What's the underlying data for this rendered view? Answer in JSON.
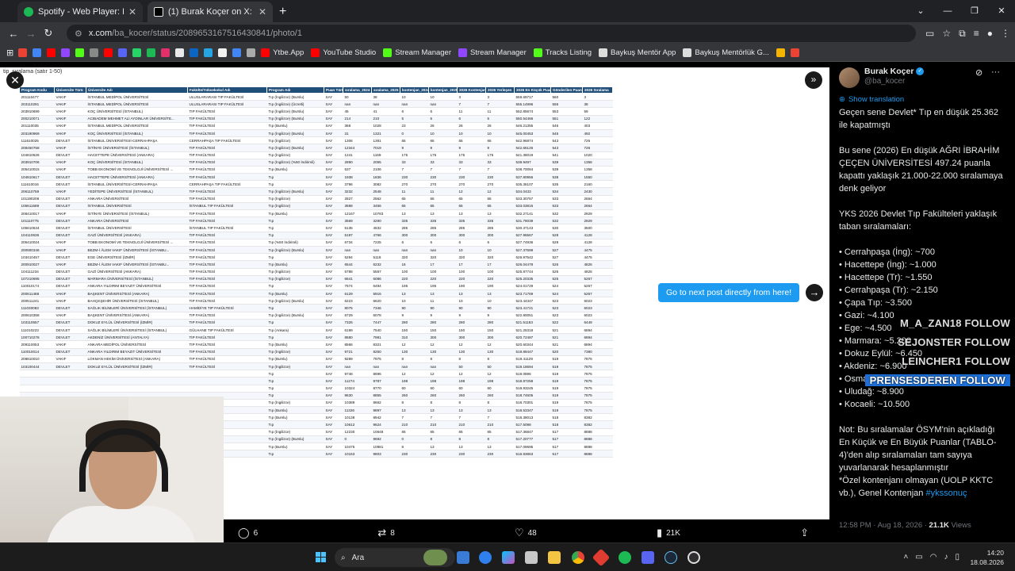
{
  "browser": {
    "tabs": [
      {
        "title": "Spotify - Web Player: Herkes için",
        "color": "#1db954",
        "active": false
      },
      {
        "title": "(1) Burak Koçer on X: \"Geçen se",
        "color": "#e7e9ea",
        "active": true
      }
    ],
    "new_tab": "+",
    "url_site": "x.com",
    "url_path": "/ba_kocer/status/2089653167516430841/photo/1",
    "bookmarks": [
      {
        "label": "",
        "color": "#ea4335"
      },
      {
        "label": "",
        "color": "#4285f4"
      },
      {
        "label": "",
        "color": "#ff0000"
      },
      {
        "label": "",
        "color": "#9147ff"
      },
      {
        "label": "",
        "color": "#53fc18"
      },
      {
        "label": "",
        "color": "#888888"
      },
      {
        "label": "",
        "color": "#ff0000"
      },
      {
        "label": "",
        "color": "#5865f2"
      },
      {
        "label": "",
        "color": "#25d366"
      },
      {
        "label": "",
        "color": "#1db954"
      },
      {
        "label": "",
        "color": "#e1306c"
      },
      {
        "label": "",
        "color": "#e7e9ea"
      },
      {
        "label": "",
        "color": "#0a66c2"
      },
      {
        "label": "",
        "color": "#26a5e4"
      },
      {
        "label": "",
        "color": "#f2f2f2"
      },
      {
        "label": "",
        "color": "#4285f4"
      },
      {
        "label": "",
        "color": "#aaaaaa"
      },
      {
        "label": "Ytbe.App",
        "color": "#ff0000"
      },
      {
        "label": "YouTube Studio",
        "color": "#ff0000"
      },
      {
        "label": "Stream Manager",
        "color": "#53fc18"
      },
      {
        "label": "Stream Manager",
        "color": "#9147ff"
      },
      {
        "label": "Tracks Listing",
        "color": "#53fc18"
      },
      {
        "label": "Baykuş Mentör App",
        "color": "#dddddd"
      },
      {
        "label": "Baykuş Mentörlük G...",
        "color": "#dddddd"
      },
      {
        "label": "",
        "color": "#f4b400"
      },
      {
        "label": "",
        "color": "#ea4335"
      }
    ]
  },
  "image": {
    "sheet_title": "tip_sıralama  (satır 1-50)",
    "columns": [
      "Program Kodu",
      "Üniversite Türü",
      "Üniversite Adı",
      "Fakülte/Yüksekokul Adı",
      "Program Adı",
      "Puan Türü",
      "sıralama_2024",
      "sıralama_2025",
      "kontenjan_2024",
      "kontenjan_2025",
      "2026 Kontenjan",
      "2026 Yerleşen",
      "2026 En Küçük Puan",
      "Gönderilen Puan",
      "2026 Sıralama"
    ],
    "rows": [
      [
        "201110477",
        "VAKIF",
        "İSTANBUL MEDİPOL ÜNİVERSİTESİ",
        "ULUSLARARASI TIP FAKÜLTESİ",
        "Tıp (İngilizce) (Burslu)",
        "SAY",
        "50",
        "38",
        "10",
        "10",
        "3",
        "3",
        "559.69717",
        "560",
        "3"
      ],
      [
        "203110291",
        "VAKIF",
        "İSTANBUL MEDİPOL ÜNİVERSİTESİ",
        "ULUSLARARASI TIP FAKÜLTESİ",
        "Tıp (İngilizce) (Ücretli)",
        "SAY",
        "nan",
        "nan",
        "nan",
        "nan",
        "7",
        "7",
        "555.14996",
        "555",
        "38"
      ],
      [
        "203910699",
        "VAKIF",
        "KOÇ ÜNİVERSİTESİ (İSTANBUL)",
        "TIP FAKÜLTESİ",
        "Tıp (İngilizce) (Burslu)",
        "SAY",
        "45",
        "41",
        "6",
        "6",
        "11",
        "11",
        "552.85674",
        "553",
        "59"
      ],
      [
        "200210071",
        "VAKIF",
        "ACIBADEM MEHMET ALİ AYDINLAR ÜNİVERSİTE...",
        "TIP FAKÜLTESİ",
        "Tıp (İngilizce) (Burslu)",
        "SAY",
        "214",
        "210",
        "5",
        "6",
        "6",
        "6",
        "550.54466",
        "551",
        "122"
      ],
      [
        "201110035",
        "VAKIF",
        "İSTANBUL MEDİPOL ÜNİVERSİTESİ",
        "TIP FAKÜLTESİ",
        "Tıp (Burslu)",
        "SAY",
        "368",
        "1028",
        "23",
        "26",
        "26",
        "26",
        "546.21355",
        "546",
        "403"
      ],
      [
        "203190969",
        "VAKIF",
        "KOÇ ÜNİVERSİTESİ (İSTANBUL)",
        "TIP FAKÜLTESİ",
        "Tıp (İngilizce) (Burslu)",
        "SAY",
        "31",
        "1321",
        "0",
        "10",
        "10",
        "10",
        "545.00453",
        "545",
        "492"
      ],
      [
        "111610025",
        "DEVLET",
        "İSTANBUL ÜNİVERSİTESİ-CERRAHPAŞA",
        "CERRAHPAŞA TIP FAKÜLTESİ",
        "Tıp (İngilizce)",
        "SAY",
        "1306",
        "1391",
        "65",
        "65",
        "65",
        "65",
        "542.96874",
        "543",
        "726"
      ],
      [
        "208450758",
        "VAKIF",
        "İSTİNYE ÜNİVERSİTESİ (İSTANBUL)",
        "TIP FAKÜLTESİ",
        "Tıp (İngilizce) (Burslu)",
        "SAY",
        "12344",
        "7019",
        "9",
        "9",
        "9",
        "9",
        "542.66126",
        "543",
        "726"
      ],
      [
        "104810626",
        "DEVLET",
        "HACETTEPE ÜNİVERSİTESİ (ANKARA)",
        "TIP FAKÜLTESİ",
        "Tıp (İngilizce)",
        "SAY",
        "1241",
        "1169",
        "175",
        "175",
        "175",
        "175",
        "541.38019",
        "541",
        "1020"
      ],
      [
        "203910706",
        "VAKIF",
        "KOÇ ÜNİVERSİTESİ (İSTANBUL)",
        "TIP FAKÜLTESİ",
        "Tıp (İngilizce) (%50 İndirimli)",
        "SAY",
        "2890",
        "2055",
        "33",
        "33",
        "33",
        "33",
        "538.9497",
        "539",
        "1358"
      ],
      [
        "205410015",
        "VAKIF",
        "TOBB EKONOMİ VE TEKNOLOJİ ÜNİVERSİTESİ ...",
        "TIP FAKÜLTESİ",
        "Tıp (Burslu)",
        "SAY",
        "537",
        "2106",
        "7",
        "7",
        "7",
        "7",
        "538.70084",
        "539",
        "1358"
      ],
      [
        "104810617",
        "DEVLET",
        "HACETTEPE ÜNİVERSİTESİ (ANKARA)",
        "TIP FAKÜLTESİ",
        "Tıp",
        "SAY",
        "1938",
        "1836",
        "230",
        "230",
        "230",
        "230",
        "537.80956",
        "538",
        "1550"
      ],
      [
        "111610016",
        "DEVLET",
        "İSTANBUL ÜNİVERSİTESİ-CERRAHPAŞA",
        "CERRAHPAŞA TIP FAKÜLTESİ",
        "Tıp",
        "SAY",
        "3796",
        "3082",
        "270",
        "270",
        "270",
        "270",
        "535.36107",
        "535",
        "2160"
      ],
      [
        "206110759",
        "VAKIF",
        "YEDİTEPE ÜNİVERSİTESİ (İSTANBUL)",
        "TIP FAKÜLTESİ",
        "Tıp (İngilizce) (Burslu)",
        "SAY",
        "3232",
        "2548",
        "11",
        "11",
        "12",
        "12",
        "534.0433",
        "534",
        "2430"
      ],
      [
        "101190208",
        "DEVLET",
        "ANKARA ÜNİVERSİTESİ",
        "TIP FAKÜLTESİ",
        "Tıp (İngilizce)",
        "SAY",
        "2827",
        "2562",
        "65",
        "65",
        "65",
        "65",
        "533.30757",
        "533",
        "2664"
      ],
      [
        "105611589",
        "DEVLET",
        "İSTANBUL ÜNİVERSİTESİ",
        "İSTANBUL TIP FAKÜLTESİ",
        "Tıp (İngilizce)",
        "SAY",
        "3688",
        "3456",
        "65",
        "65",
        "65",
        "65",
        "533.03816",
        "533",
        "2664"
      ],
      [
        "208410017",
        "VAKIF",
        "İSTİNYE ÜNİVERSİTESİ (İSTANBUL)",
        "TIP FAKÜLTESİ",
        "Tıp (Burslu)",
        "SAY",
        "12167",
        "10783",
        "13",
        "13",
        "13",
        "13",
        "532.27141",
        "532",
        "2929"
      ],
      [
        "101110775",
        "DEVLET",
        "ANKARA ÜNİVERSİTESİ",
        "TIP FAKÜLTESİ",
        "Tıp",
        "SAY",
        "3569",
        "3290",
        "335",
        "335",
        "335",
        "335",
        "531.78039",
        "532",
        "2929"
      ],
      [
        "105610634",
        "DEVLET",
        "İSTANBUL ÜNİVERSİTESİ",
        "İSTANBUL TIP FAKÜLTESİ",
        "Tıp",
        "SAY",
        "5135",
        "4532",
        "285",
        "285",
        "285",
        "285",
        "530.37143",
        "530",
        "3500"
      ],
      [
        "104110636",
        "DEVLET",
        "GAZİ ÜNİVERSİTESİ (ANKARA)",
        "TIP FAKÜLTESİ",
        "Tıp",
        "SAY",
        "5197",
        "4766",
        "300",
        "300",
        "300",
        "300",
        "527.96567",
        "528",
        "4128"
      ],
      [
        "205410024",
        "VAKIF",
        "TOBB EKONOMİ VE TEKNOLOJİ ÜNİVERSİTESİ ...",
        "TIP FAKÜLTESİ",
        "Tıp (%50 İndirimli)",
        "SAY",
        "6734",
        "7225",
        "6",
        "6",
        "6",
        "6",
        "527.74936",
        "528",
        "4128"
      ],
      [
        "200900346",
        "VAKIF",
        "BEZM-İ ÂLEM VAKIF ÜNİVERSİTESİ (İSTANBU...",
        "TIP FAKÜLTESİ",
        "Tıp (İngilizce) (Burslu)",
        "SAY",
        "nan",
        "nan",
        "nan",
        "nan",
        "10",
        "10",
        "527.37599",
        "527",
        "4475"
      ],
      [
        "103410457",
        "DEVLET",
        "EGE ÜNİVERSİTESİ (İZMİR)",
        "TIP FAKÜLTESİ",
        "Tıp",
        "SAY",
        "5294",
        "5118",
        "320",
        "320",
        "320",
        "320",
        "526.97542",
        "527",
        "4475"
      ],
      [
        "200910027",
        "VAKIF",
        "BEZM-İ ÂLEM VAKIF ÜNİVERSİTESİ (İSTANBU...",
        "TIP FAKÜLTESİ",
        "Tıp (Burslu)",
        "SAY",
        "6544",
        "6232",
        "16",
        "17",
        "17",
        "17",
        "526.04478",
        "526",
        "4826"
      ],
      [
        "104111234",
        "DEVLET",
        "GAZİ ÜNİVERSİTESİ (ANKARA)",
        "TIP FAKÜLTESİ",
        "Tıp (İngilizce)",
        "SAY",
        "5788",
        "5567",
        "100",
        "100",
        "100",
        "100",
        "525.87744",
        "526",
        "4826"
      ],
      [
        "107210695",
        "DEVLET",
        "MARMARA ÜNİVERSİTESİ (İSTANBUL)",
        "TIP FAKÜLTESİ",
        "Tıp (İngilizce)",
        "SAY",
        "6641",
        "6086",
        "220",
        "220",
        "220",
        "220",
        "525.20335",
        "525",
        "5267"
      ],
      [
        "110010174",
        "DEVLET",
        "ANKARA YILDIRIM BEYAZIT ÜNİVERSİTESİ",
        "TIP FAKÜLTESİ",
        "Tıp",
        "SAY",
        "7574",
        "6494",
        "195",
        "195",
        "190",
        "190",
        "524.01729",
        "524",
        "5267"
      ],
      [
        "200611488",
        "VAKIF",
        "BAŞKENT ÜNİVERSİTESİ (ANKARA)",
        "TIP FAKÜLTESİ",
        "Tıp (Burslu)",
        "SAY",
        "6129",
        "5916",
        "13",
        "13",
        "13",
        "13",
        "523.71769",
        "524",
        "5267"
      ],
      [
        "200511241",
        "VAKIF",
        "BAHÇEŞEHİR ÜNİVERSİTESİ (İSTANBUL)",
        "TIP FAKÜLTESİ",
        "Tıp (İngilizce) (Burslu)",
        "SAY",
        "6223",
        "6620",
        "10",
        "11",
        "10",
        "10",
        "523.44347",
        "523",
        "6023"
      ],
      [
        "111030083",
        "DEVLET",
        "SAĞLIK BİLİMLERİ ÜNİVERSİTESİ (İSTANBUL)",
        "HAMİDİYE TIP FAKÜLTESİ",
        "Tıp",
        "SAY",
        "8075",
        "7346",
        "90",
        "90",
        "90",
        "90",
        "523.41721",
        "523",
        "6023"
      ],
      [
        "200610358",
        "VAKIF",
        "BAŞKENT ÜNİVERSİTESİ (ANKARA)",
        "TIP FAKÜLTESİ",
        "Tıp (İngilizce) (Burslu)",
        "SAY",
        "6729",
        "6078",
        "9",
        "9",
        "9",
        "9",
        "522.80051",
        "523",
        "6023"
      ],
      [
        "103110557",
        "DEVLET",
        "DOKUZ EYLÜL ÜNİVERSİTESİ (İZMİR)",
        "TIP FAKÜLTESİ",
        "Tıp",
        "SAY",
        "7326",
        "7447",
        "280",
        "280",
        "280",
        "280",
        "521.51183",
        "522",
        "6449"
      ],
      [
        "111010223",
        "DEVLET",
        "SAĞLIK BİLİMLERİ ÜNİVERSİTESİ (İSTANBUL)",
        "GÜLHANE TIP FAKÜLTESİ",
        "Tıp (Ankara)",
        "SAY",
        "6199",
        "7540",
        "150",
        "150",
        "150",
        "150",
        "521.25318",
        "521",
        "6894"
      ],
      [
        "100710278",
        "DEVLET",
        "AKDENİZ ÜNİVERSİTESİ (ANTALYA)",
        "TIP FAKÜLTESİ",
        "Tıp",
        "SAY",
        "8580",
        "7981",
        "310",
        "300",
        "300",
        "300",
        "520.72487",
        "521",
        "6894"
      ],
      [
        "209110053",
        "VAKIF",
        "ANKARA MEDİPOL ÜNİVERSİTESİ",
        "TIP FAKÜLTESİ",
        "Tıp (Burslu)",
        "SAY",
        "8566",
        "8321",
        "12",
        "12",
        "12",
        "12",
        "520.60344",
        "521",
        "6894"
      ],
      [
        "110010014",
        "DEVLET",
        "ANKARA YILDIRIM BEYAZIT ÜNİVERSİTESİ",
        "TIP FAKÜLTESİ",
        "Tıp (İngilizce)",
        "SAY",
        "9721",
        "8250",
        "130",
        "130",
        "130",
        "130",
        "519.89447",
        "520",
        "7380"
      ],
      [
        "208810010",
        "VAKIF",
        "LOKMAN HEKİM ÜNİVERSİTESİ (ANKARA)",
        "TIP FAKÜLTESİ",
        "Tıp (Burslu)",
        "SAY",
        "9289",
        "7975",
        "8",
        "8",
        "8",
        "8",
        "519.41129",
        "519",
        "7875"
      ],
      [
        "103100444",
        "DEVLET",
        "DOKUZ EYLÜL ÜNİVERSİTESİ (İZMİR)",
        "TIP FAKÜLTESİ",
        "Tıp (İngilizce)",
        "SAY",
        "nan",
        "nan",
        "nan",
        "nan",
        "50",
        "50",
        "519.18694",
        "519",
        "7875"
      ],
      [
        "",
        "",
        "",
        "",
        "Tıp",
        "SAY",
        "9748",
        "8696",
        "12",
        "12",
        "12",
        "12",
        "519.0896",
        "519",
        "7875"
      ],
      [
        "",
        "",
        "",
        "",
        "Tıp",
        "SAY",
        "11274",
        "9787",
        "198",
        "198",
        "198",
        "198",
        "518.97258",
        "519",
        "7875"
      ],
      [
        "",
        "",
        "",
        "",
        "Tıp",
        "SAY",
        "10324",
        "8770",
        "60",
        "60",
        "60",
        "60",
        "518.93245",
        "519",
        "7875"
      ],
      [
        "",
        "",
        "",
        "",
        "Tıp",
        "SAY",
        "9630",
        "8855",
        "260",
        "260",
        "260",
        "260",
        "518.74605",
        "519",
        "7875"
      ],
      [
        "",
        "",
        "",
        "",
        "Tıp (İngilizce)",
        "SAY",
        "10389",
        "8662",
        "8",
        "8",
        "8",
        "8",
        "518.70301",
        "519",
        "7875"
      ],
      [
        "",
        "",
        "",
        "",
        "Tıp (Burslu)",
        "SAY",
        "11326",
        "9897",
        "13",
        "13",
        "13",
        "13",
        "518.53347",
        "519",
        "7875"
      ],
      [
        "",
        "",
        "",
        "",
        "Tıp (Burslu)",
        "SAY",
        "10138",
        "8942",
        "7",
        "7",
        "7",
        "7",
        "518.38013",
        "518",
        "8382"
      ],
      [
        "",
        "",
        "",
        "",
        "Tıp",
        "SAY",
        "10612",
        "9624",
        "210",
        "210",
        "210",
        "210",
        "517.5098",
        "518",
        "8382"
      ],
      [
        "",
        "",
        "",
        "",
        "Tıp (İngilizce)",
        "SAY",
        "12230",
        "10648",
        "65",
        "65",
        "65",
        "65",
        "517.36847",
        "517",
        "8888"
      ],
      [
        "",
        "",
        "",
        "",
        "Tıp (İngilizce) (Burslu)",
        "SAY",
        "0",
        "9692",
        "0",
        "8",
        "8",
        "8",
        "517.20777",
        "517",
        "8888"
      ],
      [
        "",
        "",
        "",
        "",
        "Tıp (Burslu)",
        "SAY",
        "10475",
        "10981",
        "8",
        "13",
        "13",
        "13",
        "517.09695",
        "517",
        "8888"
      ],
      [
        "",
        "",
        "",
        "",
        "Tıp",
        "SAY",
        "10163",
        "9803",
        "230",
        "230",
        "230",
        "230",
        "516.93863",
        "517",
        "8888"
      ]
    ],
    "next_post_label": "Go to next post directly from here!"
  },
  "actions": {
    "replies": "6",
    "reposts": "8",
    "likes": "48",
    "views": "21K"
  },
  "tweet": {
    "name": "Burak Koçer",
    "handle": "@ba_kocer",
    "show_translation": "Show translation",
    "p1": "Geçen sene Devlet* Tıp en düşük 25.362 ile kapatmıştı",
    "p2": "Bu sene (2026) En düşük AĞRI İBRAHİM ÇEÇEN ÜNİVERSİTESİ 497.24 puanla kapattı yaklaşık 21.000-22.000 sıralamaya denk geliyor",
    "p3": "YKS 2026 Devlet Tıp Fakülteleri yaklaşık taban sıralamaları:",
    "list": [
      "• Cerrahpaşa (İng): ~700",
      "• Hacettepe (İng): ~1.000",
      "• Hacettepe (Tr): ~1.550",
      "• Cerrahpaşa (Tr): ~2.150",
      "• Çapa Tıp: ~3.500",
      "• Gazi: ~4.100",
      "• Ege: ~4.500",
      "• Marmara: ~5.200",
      "• Dokuz Eylül: ~6.450",
      "• Akdeniz: ~6.900",
      "• Osmangazi: ~7.300",
      "• Uludağ: ~8.900",
      "• Kocaeli: ~10.500"
    ],
    "p5": "Not: Bu sıralamalar ÖSYM'nin açıkladığı En Küçük ve En Büyük Puanlar (TABLO-4)'den alıp sıralamaları tam sayıya yuvarlanarak hesaplanmıştır",
    "p6a": "*Özel kontenjanı olmayan (UOLP KKTC vb.), Genel Kontenjan ",
    "hashtag": "#ykssonuç",
    "time": "12:58 PM · Aug 18, 2026 · ",
    "views_count": "21.1K",
    "views_label": " Views"
  },
  "stream_overlay": {
    "follows": [
      {
        "text": "M_A_ZAN18  FOLLOW",
        "highlight": false
      },
      {
        "text": "SEJONSTER  FOLLOW",
        "highlight": false
      },
      {
        "text": "LEINCHER1  FOLLOW",
        "highlight": false
      },
      {
        "text": "PRENSESDEREN  FOLLOW",
        "highlight": true
      }
    ]
  },
  "taskbar": {
    "search_placeholder": "Ara",
    "time": "14:20",
    "date": "18.08.2026"
  }
}
